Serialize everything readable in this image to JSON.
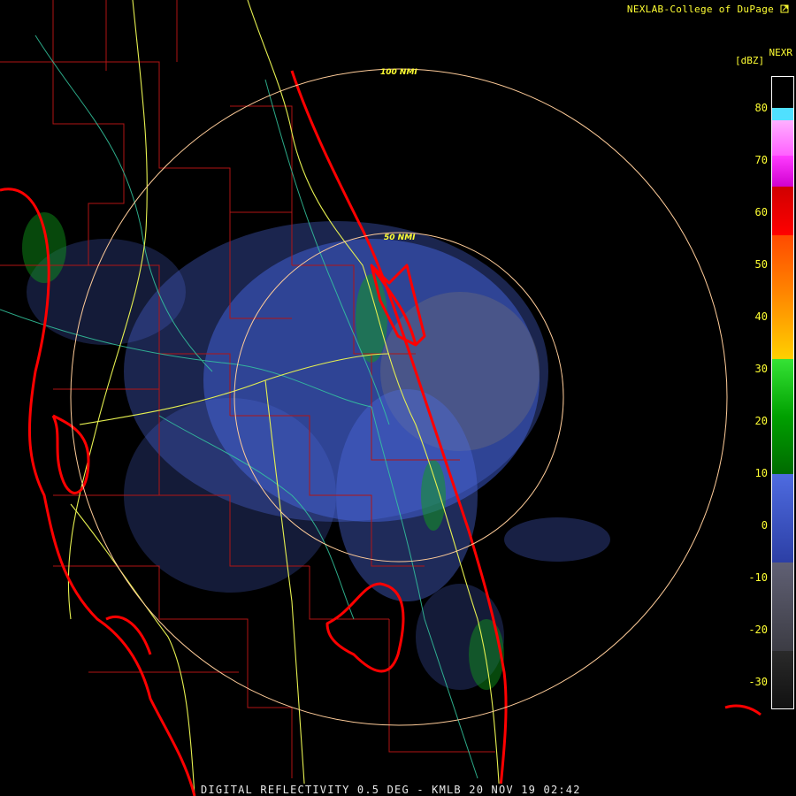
{
  "credit": "NEXLAB-College of DuPage",
  "credit_icon": "external-link-icon",
  "product_code": "NEXR",
  "unit": "[dBZ]",
  "caption": "DIGITAL REFLECTIVITY 0.5 DEG - KMLB 20 NOV 19 02:42",
  "rings": [
    {
      "label": "100 NMI"
    },
    {
      "label": "50 NMI"
    }
  ],
  "legend": {
    "ticks": [
      "80",
      "70",
      "60",
      "50",
      "40",
      "30",
      "20",
      "10",
      "0",
      "-10",
      "-20",
      "-30"
    ],
    "colors": {
      "dbz_80": "#50e0ff",
      "dbz_70": "#ff3cff",
      "dbz_60": "#ff0000",
      "dbz_50": "#ff7a00",
      "dbz_35": "#ffff00",
      "dbz_30": "#35e335",
      "dbz_15": "#008a00",
      "dbz_10": "#4e6be0",
      "dbz_0": "#1d2a8f",
      "dbz_m10": "#6a6a7a",
      "dbz_m30": "#111111"
    }
  },
  "map_colors": {
    "coastline": "#ff0000",
    "county_lines": "#b01515",
    "highways": "#e6f050",
    "rivers": "#34c8a0",
    "range_rings": "#ffcc99",
    "echo_light": "#4e6be0",
    "echo_gray": "#6a6a7a",
    "echo_green": "#10a01a"
  }
}
